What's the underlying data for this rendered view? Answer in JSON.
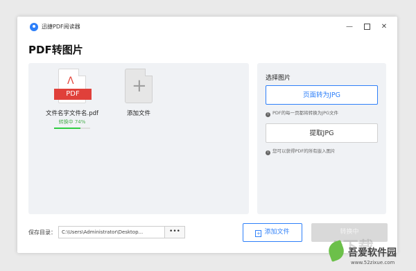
{
  "window": {
    "app_name": "迅捷PDF阅读器",
    "minimize_symbol": "—",
    "close_symbol": "✕"
  },
  "page_title": "PDF转图片",
  "files": [
    {
      "type_label": "PDF",
      "name": "文件名字文件名.pdf",
      "status": "转换中  74%",
      "progress": 0.74
    }
  ],
  "add_file_card": {
    "label": "添加文件",
    "icon": "plus-icon"
  },
  "options": {
    "title": "选择图片",
    "button_page_to_jpg": "页面转为JPG",
    "tip_page_to_jpg": "PDF的每一页都将转换为JPG文件",
    "button_extract_jpg": "提取JPG",
    "tip_extract_jpg": "您可以获得PDF的所有嵌入图片",
    "info_icon": "i"
  },
  "footer": {
    "save_label": "保存目录：",
    "save_path": "C:\\Users\\Administrator\\Desktop...",
    "browse_label": "•••",
    "add_file_button": "添加文件",
    "convert_button": "转换中"
  },
  "watermark": {
    "bg_text": "k下载",
    "title": "吾爱软件园",
    "url": "www.52zixue.com"
  },
  "colors": {
    "accent": "#2d7ff9",
    "pdf_red": "#e0403a",
    "progress_green": "#2ecc40",
    "panel_bg": "#f0f2f5"
  }
}
